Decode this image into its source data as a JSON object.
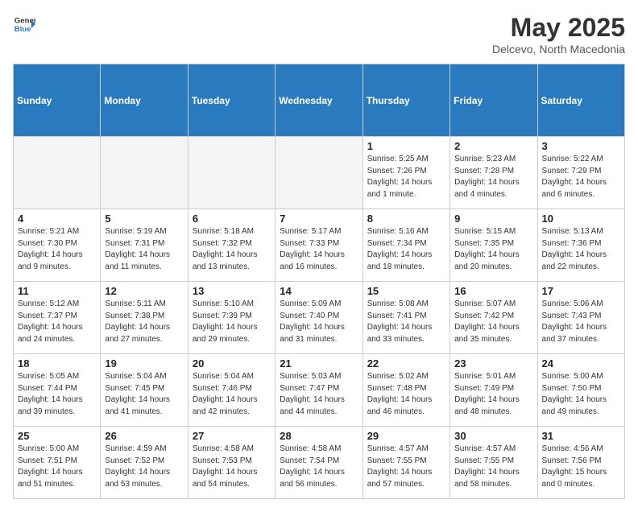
{
  "header": {
    "logo_line1": "General",
    "logo_line2": "Blue",
    "month": "May 2025",
    "location": "Delcevo, North Macedonia"
  },
  "days_of_week": [
    "Sunday",
    "Monday",
    "Tuesday",
    "Wednesday",
    "Thursday",
    "Friday",
    "Saturday"
  ],
  "weeks": [
    [
      {
        "day": "",
        "info": "",
        "empty": true
      },
      {
        "day": "",
        "info": "",
        "empty": true
      },
      {
        "day": "",
        "info": "",
        "empty": true
      },
      {
        "day": "",
        "info": "",
        "empty": true
      },
      {
        "day": "1",
        "info": "Sunrise: 5:25 AM\nSunset: 7:26 PM\nDaylight: 14 hours\nand 1 minute.",
        "empty": false
      },
      {
        "day": "2",
        "info": "Sunrise: 5:23 AM\nSunset: 7:28 PM\nDaylight: 14 hours\nand 4 minutes.",
        "empty": false
      },
      {
        "day": "3",
        "info": "Sunrise: 5:22 AM\nSunset: 7:29 PM\nDaylight: 14 hours\nand 6 minutes.",
        "empty": false
      }
    ],
    [
      {
        "day": "4",
        "info": "Sunrise: 5:21 AM\nSunset: 7:30 PM\nDaylight: 14 hours\nand 9 minutes.",
        "empty": false
      },
      {
        "day": "5",
        "info": "Sunrise: 5:19 AM\nSunset: 7:31 PM\nDaylight: 14 hours\nand 11 minutes.",
        "empty": false
      },
      {
        "day": "6",
        "info": "Sunrise: 5:18 AM\nSunset: 7:32 PM\nDaylight: 14 hours\nand 13 minutes.",
        "empty": false
      },
      {
        "day": "7",
        "info": "Sunrise: 5:17 AM\nSunset: 7:33 PM\nDaylight: 14 hours\nand 16 minutes.",
        "empty": false
      },
      {
        "day": "8",
        "info": "Sunrise: 5:16 AM\nSunset: 7:34 PM\nDaylight: 14 hours\nand 18 minutes.",
        "empty": false
      },
      {
        "day": "9",
        "info": "Sunrise: 5:15 AM\nSunset: 7:35 PM\nDaylight: 14 hours\nand 20 minutes.",
        "empty": false
      },
      {
        "day": "10",
        "info": "Sunrise: 5:13 AM\nSunset: 7:36 PM\nDaylight: 14 hours\nand 22 minutes.",
        "empty": false
      }
    ],
    [
      {
        "day": "11",
        "info": "Sunrise: 5:12 AM\nSunset: 7:37 PM\nDaylight: 14 hours\nand 24 minutes.",
        "empty": false
      },
      {
        "day": "12",
        "info": "Sunrise: 5:11 AM\nSunset: 7:38 PM\nDaylight: 14 hours\nand 27 minutes.",
        "empty": false
      },
      {
        "day": "13",
        "info": "Sunrise: 5:10 AM\nSunset: 7:39 PM\nDaylight: 14 hours\nand 29 minutes.",
        "empty": false
      },
      {
        "day": "14",
        "info": "Sunrise: 5:09 AM\nSunset: 7:40 PM\nDaylight: 14 hours\nand 31 minutes.",
        "empty": false
      },
      {
        "day": "15",
        "info": "Sunrise: 5:08 AM\nSunset: 7:41 PM\nDaylight: 14 hours\nand 33 minutes.",
        "empty": false
      },
      {
        "day": "16",
        "info": "Sunrise: 5:07 AM\nSunset: 7:42 PM\nDaylight: 14 hours\nand 35 minutes.",
        "empty": false
      },
      {
        "day": "17",
        "info": "Sunrise: 5:06 AM\nSunset: 7:43 PM\nDaylight: 14 hours\nand 37 minutes.",
        "empty": false
      }
    ],
    [
      {
        "day": "18",
        "info": "Sunrise: 5:05 AM\nSunset: 7:44 PM\nDaylight: 14 hours\nand 39 minutes.",
        "empty": false
      },
      {
        "day": "19",
        "info": "Sunrise: 5:04 AM\nSunset: 7:45 PM\nDaylight: 14 hours\nand 41 minutes.",
        "empty": false
      },
      {
        "day": "20",
        "info": "Sunrise: 5:04 AM\nSunset: 7:46 PM\nDaylight: 14 hours\nand 42 minutes.",
        "empty": false
      },
      {
        "day": "21",
        "info": "Sunrise: 5:03 AM\nSunset: 7:47 PM\nDaylight: 14 hours\nand 44 minutes.",
        "empty": false
      },
      {
        "day": "22",
        "info": "Sunrise: 5:02 AM\nSunset: 7:48 PM\nDaylight: 14 hours\nand 46 minutes.",
        "empty": false
      },
      {
        "day": "23",
        "info": "Sunrise: 5:01 AM\nSunset: 7:49 PM\nDaylight: 14 hours\nand 48 minutes.",
        "empty": false
      },
      {
        "day": "24",
        "info": "Sunrise: 5:00 AM\nSunset: 7:50 PM\nDaylight: 14 hours\nand 49 minutes.",
        "empty": false
      }
    ],
    [
      {
        "day": "25",
        "info": "Sunrise: 5:00 AM\nSunset: 7:51 PM\nDaylight: 14 hours\nand 51 minutes.",
        "empty": false
      },
      {
        "day": "26",
        "info": "Sunrise: 4:59 AM\nSunset: 7:52 PM\nDaylight: 14 hours\nand 53 minutes.",
        "empty": false
      },
      {
        "day": "27",
        "info": "Sunrise: 4:58 AM\nSunset: 7:53 PM\nDaylight: 14 hours\nand 54 minutes.",
        "empty": false
      },
      {
        "day": "28",
        "info": "Sunrise: 4:58 AM\nSunset: 7:54 PM\nDaylight: 14 hours\nand 56 minutes.",
        "empty": false
      },
      {
        "day": "29",
        "info": "Sunrise: 4:57 AM\nSunset: 7:55 PM\nDaylight: 14 hours\nand 57 minutes.",
        "empty": false
      },
      {
        "day": "30",
        "info": "Sunrise: 4:57 AM\nSunset: 7:55 PM\nDaylight: 14 hours\nand 58 minutes.",
        "empty": false
      },
      {
        "day": "31",
        "info": "Sunrise: 4:56 AM\nSunset: 7:56 PM\nDaylight: 15 hours\nand 0 minutes.",
        "empty": false
      }
    ]
  ]
}
